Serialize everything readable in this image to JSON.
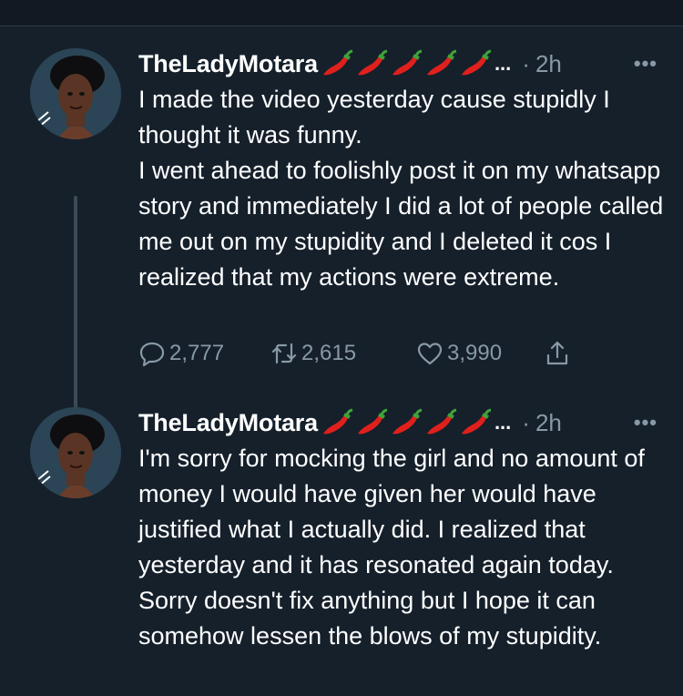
{
  "tweets": [
    {
      "author": "TheLadyMotara",
      "name_suffix": "...",
      "separator": "·",
      "time": "2h",
      "more": "•••",
      "text": "I made the video yesterday cause stupidly I thought it was funny.\nI went ahead to foolishly post it on my whatsapp story and immediately I did a lot of people called me out on my stupidity and I deleted it cos I realized that my actions were extreme.",
      "replies": "2,777",
      "retweets": "2,615",
      "likes": "3,990"
    },
    {
      "author": "TheLadyMotara",
      "name_suffix": "...",
      "separator": "·",
      "time": "2h",
      "more": "•••",
      "text": "I'm sorry for mocking the girl and no amount of money I would have given her would have justified what I actually did. I realized that yesterday and it has resonated again today. Sorry doesn't fix anything but I hope it can somehow lessen the blows of my stupidity."
    }
  ],
  "icons": {
    "pepper": "hot-pepper-icon",
    "reply": "reply-icon",
    "retweet": "retweet-icon",
    "like": "heart-icon",
    "share": "share-icon"
  },
  "colors": {
    "background": "#15202b",
    "text": "#ffffff",
    "secondary": "#8899a6",
    "thread_line": "#3d4b57"
  }
}
